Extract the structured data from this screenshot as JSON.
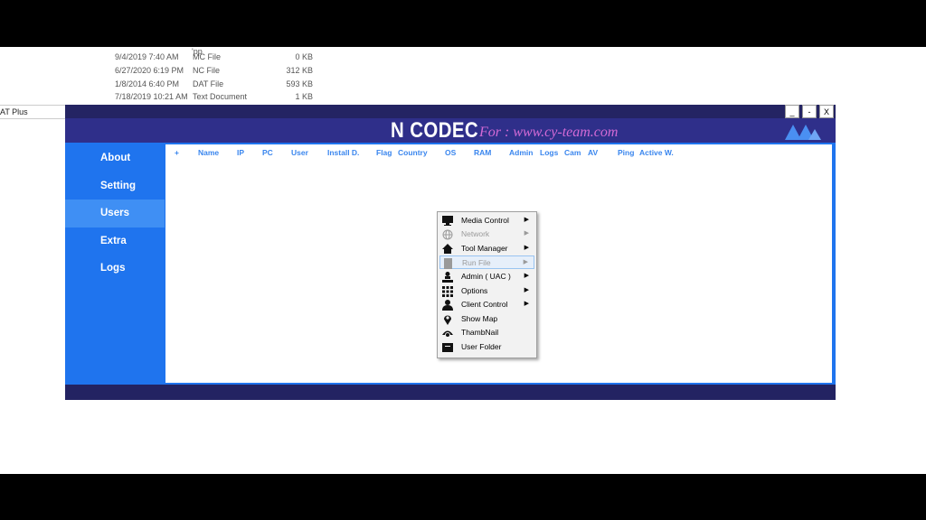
{
  "explorer": {
    "taskbar_label": "AT Plus",
    "top_clip": "'pp",
    "files": [
      {
        "date": "9/4/2019 7:40 AM",
        "type": "MC File",
        "size": "0 KB"
      },
      {
        "date": "6/27/2020 6:19 PM",
        "type": "NC File",
        "size": "312 KB"
      },
      {
        "date": "1/8/2014 6:40 PM",
        "type": "DAT File",
        "size": "593 KB"
      },
      {
        "date": "7/18/2019 10:21 AM",
        "type": "Text Document",
        "size": "1 KB"
      }
    ]
  },
  "app": {
    "title": "N CODEC",
    "subtitle": "For : www.cy-team.com",
    "window_buttons": {
      "minimize": "_",
      "restore": "-",
      "close": "X"
    },
    "sidebar": {
      "items": [
        {
          "label": "About"
        },
        {
          "label": "Setting"
        },
        {
          "label": "Users"
        },
        {
          "label": "Extra"
        },
        {
          "label": "Logs"
        }
      ],
      "active": "Users"
    },
    "columns": [
      "+",
      "Name",
      "IP",
      "PC",
      "User",
      "Install D.",
      "Flag",
      "Country",
      "OS",
      "RAM",
      "Admin",
      "Logs",
      "Cam",
      "AV",
      "Ping",
      "Active W."
    ],
    "accent": "#1f74ee",
    "header_color": "#242463",
    "subtitle_color": "#d36ad6"
  },
  "context_menu": {
    "items": [
      {
        "label": "Media Control",
        "icon": "monitor-icon",
        "submenu": true,
        "disabled": false
      },
      {
        "label": "Network",
        "icon": "globe-icon",
        "submenu": true,
        "disabled": true
      },
      {
        "label": "Tool Manager",
        "icon": "home-icon",
        "submenu": true,
        "disabled": false
      },
      {
        "label": "Run File",
        "icon": "file-icon",
        "submenu": true,
        "disabled": true,
        "hover": true
      },
      {
        "label": "Admin ( UAC )",
        "icon": "admin-icon",
        "submenu": true,
        "disabled": false
      },
      {
        "label": "Options",
        "icon": "grid-icon",
        "submenu": true,
        "disabled": false
      },
      {
        "label": "Client Control",
        "icon": "user-icon",
        "submenu": true,
        "disabled": false
      },
      {
        "label": "Show Map",
        "icon": "map-pin-icon",
        "submenu": false,
        "disabled": false
      },
      {
        "label": "ThambNail",
        "icon": "eye-icon",
        "submenu": false,
        "disabled": false
      },
      {
        "label": "User Folder",
        "icon": "folder-icon",
        "submenu": false,
        "disabled": false
      }
    ],
    "submenu_arrow": "▶"
  }
}
